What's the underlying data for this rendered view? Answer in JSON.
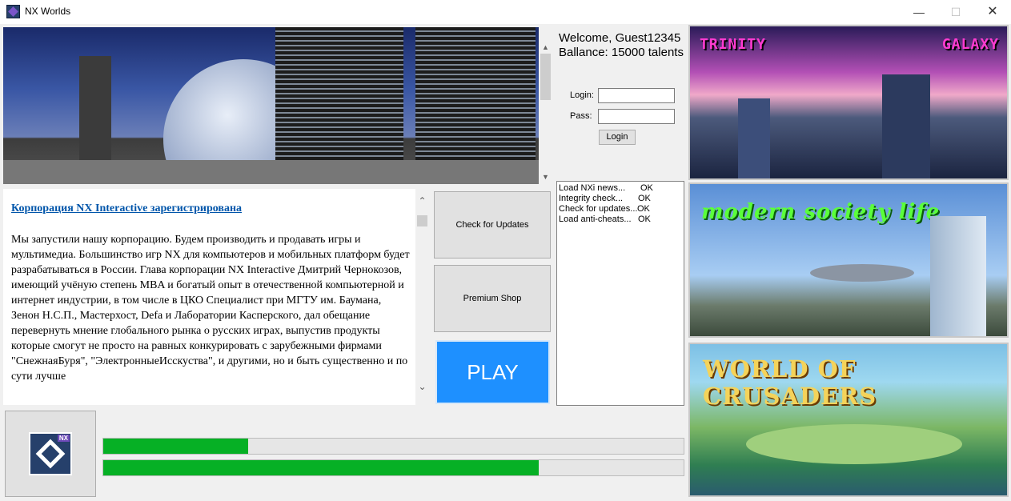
{
  "window": {
    "title": "NX Worlds",
    "minimize": "—",
    "maximize": "☐",
    "close": "✕"
  },
  "user": {
    "welcome": "Welcome, Guest12345",
    "balance": "Ballance: 15000 talents"
  },
  "login": {
    "login_label": "Login:",
    "pass_label": "Pass:",
    "login_value": "",
    "pass_value": "",
    "button": "Login"
  },
  "log": [
    {
      "task": "Load NXi news...",
      "status": "OK"
    },
    {
      "task": "Integrity check...",
      "status": "OK"
    },
    {
      "task": "Check for updates...",
      "status": "OK"
    },
    {
      "task": "Load anti-cheats...",
      "status": "OK"
    }
  ],
  "news": {
    "headline": "Корпорация NX Interactive зарегистрирована",
    "body": "Мы запустили нашу корпорацию. Будем производить и продавать игры и мультимедиа. Большинство игр NX для компьютеров и мобильных платформ будет разрабатываться в России. Глава корпорации NX Interactive Дмитрий Чернокозов, имеющий учёную степень MBA и богатый опыт в отечественной компьютерной и интернет индустрии, в том числе в ЦКО Специалист при МГТУ им. Баумана, Зенон Н.С.П., Мастерхост, Defa и Лаборатории Касперского, дал обещание перевернуть мнение глобального рынка о русских играх, выпустив продукты которые смогут не просто на равных конкурировать с зарубежными фирмами \"СнежнаяБуря\", \"ЭлектронныеИсскуства\", и другими, но и быть существенно и по сути лучше"
  },
  "buttons": {
    "check_updates": "Check for Updates",
    "premium_shop": "Premium Shop",
    "play": "PLAY"
  },
  "logo": {
    "badge": "NX"
  },
  "progress": {
    "bar1": 0.25,
    "bar2": 0.75
  },
  "games": [
    {
      "title_left": "TRINITY",
      "title_right": "GALAXY"
    },
    {
      "title": "modern society life"
    },
    {
      "title": "WORLD OF CRUSADERS"
    }
  ],
  "colors": {
    "play": "#1e90ff",
    "progress": "#06b025",
    "headline": "#0055aa"
  }
}
